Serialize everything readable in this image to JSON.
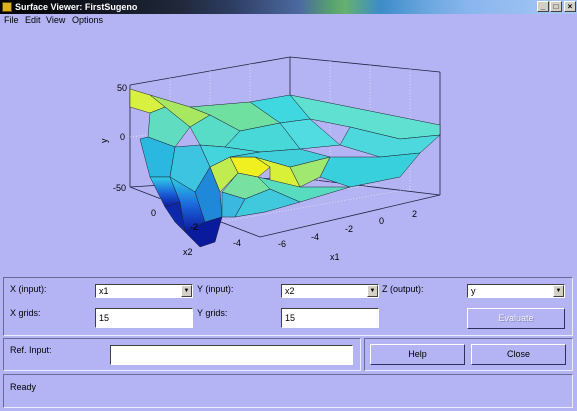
{
  "window": {
    "title": "Surface Viewer: FirstSugeno"
  },
  "title_buttons": {
    "minimize": "_",
    "maximize": "□",
    "close": "×"
  },
  "menu": {
    "items": [
      "File",
      "Edit",
      "View",
      "Options"
    ]
  },
  "plot": {
    "zlabel": "y",
    "xlabel": "x1",
    "ylabel": "x2",
    "z_ticks": [
      "50",
      "0",
      "-50"
    ],
    "x1_ticks": [
      "-6",
      "-4",
      "-2",
      "0",
      "2"
    ],
    "x2_ticks": [
      "0",
      "-2",
      "-4"
    ],
    "colors": {
      "low": "#0a1a9c",
      "mid": "#20c8e0",
      "high": "#f0f020",
      "axes_bg": "#b4b4f4"
    }
  },
  "chart_data": {
    "type": "surface",
    "xlabel": "x1",
    "ylabel": "x2",
    "zlabel": "y",
    "x1_range": [
      -7,
      3
    ],
    "x2_range": [
      -5,
      1.5
    ],
    "z_range": [
      -55,
      55
    ],
    "grid": true
  },
  "controls": {
    "x_input_label": "X (input):",
    "x_input_value": "x1",
    "y_input_label": "Y (input):",
    "y_input_value": "x2",
    "z_output_label": "Z (output):",
    "z_output_value": "y",
    "x_grids_label": "X grids:",
    "x_grids_value": "15",
    "y_grids_label": "Y grids:",
    "y_grids_value": "15",
    "evaluate_label": "Evaluate",
    "ref_input_label": "Ref. Input:",
    "ref_input_value": "",
    "help_label": "Help",
    "close_label": "Close"
  },
  "status": {
    "text": "Ready"
  }
}
